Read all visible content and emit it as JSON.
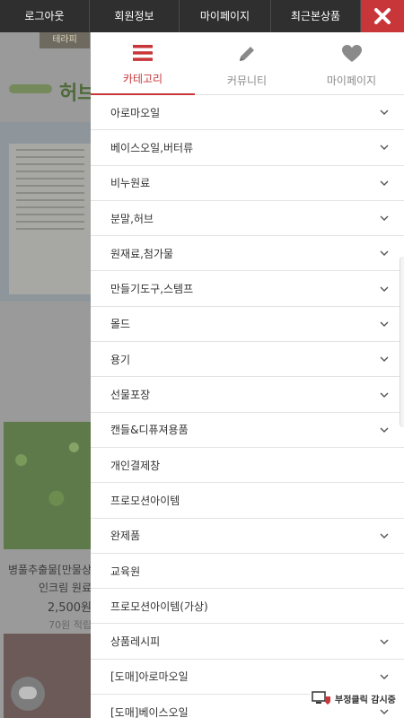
{
  "topbar": {
    "items": [
      "로그아웃",
      "회원정보",
      "마이페이지",
      "최근본상품"
    ],
    "close_icon": "close-icon"
  },
  "background": {
    "logo_text": "테라피",
    "brand_text": "허브",
    "product_title": "병풀추출물[만물상",
    "product_sub": "인크림 원료",
    "product_price": "2,500원",
    "product_points": "70원 적립"
  },
  "drawer": {
    "tabs": [
      {
        "label": "카테고리",
        "icon": "menu-icon",
        "active": true
      },
      {
        "label": "커뮤니티",
        "icon": "pencil-icon",
        "active": false
      },
      {
        "label": "마이페이지",
        "icon": "heart-icon",
        "active": false
      }
    ],
    "categories": [
      {
        "label": "아로마오일",
        "has_submenu": true
      },
      {
        "label": "베이스오일,버터류",
        "has_submenu": true
      },
      {
        "label": "비누원료",
        "has_submenu": true
      },
      {
        "label": "분말,허브",
        "has_submenu": true
      },
      {
        "label": "원재료,첨가물",
        "has_submenu": true
      },
      {
        "label": "만들기도구,스템프",
        "has_submenu": true
      },
      {
        "label": "몰드",
        "has_submenu": true
      },
      {
        "label": "용기",
        "has_submenu": true
      },
      {
        "label": "선물포장",
        "has_submenu": true
      },
      {
        "label": "캔들&디퓨져용품",
        "has_submenu": true
      },
      {
        "label": "개인결제창",
        "has_submenu": false
      },
      {
        "label": "프로모션아이템",
        "has_submenu": false
      },
      {
        "label": "완제품",
        "has_submenu": true
      },
      {
        "label": "교육원",
        "has_submenu": false
      },
      {
        "label": "프로모션아이템(가상)",
        "has_submenu": false
      },
      {
        "label": "상품레시피",
        "has_submenu": true
      },
      {
        "label": "[도매]아로마오일",
        "has_submenu": true
      },
      {
        "label": "[도매]베이스오일",
        "has_submenu": true
      }
    ]
  },
  "badge": {
    "label": "부정클릭 감시중"
  },
  "colors": {
    "accent": "#c9363a",
    "topbar": "#2f2f2f"
  }
}
